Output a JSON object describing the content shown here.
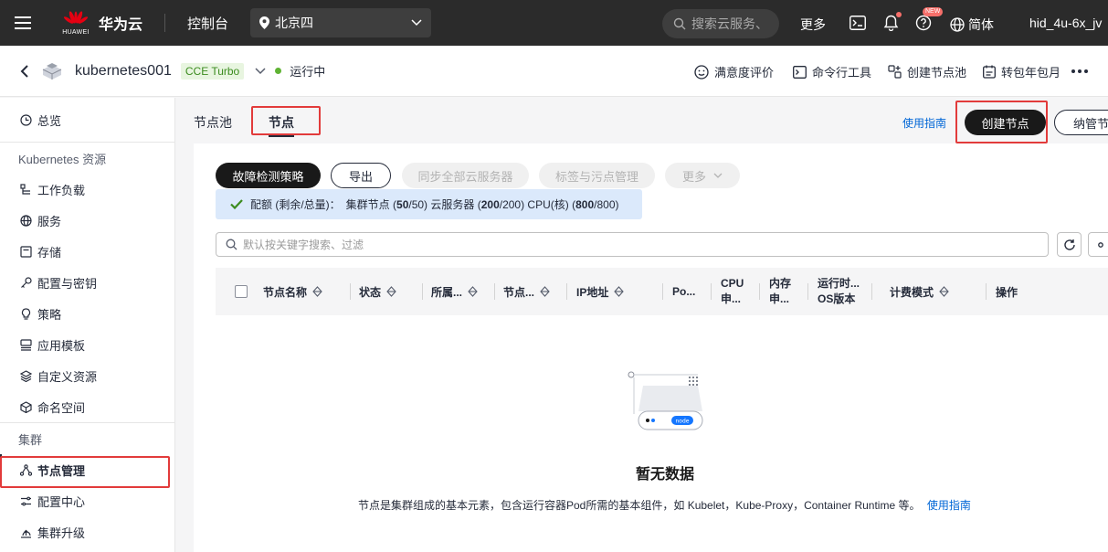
{
  "topbar": {
    "brand": "华为云",
    "logo_text": "HUAWEI",
    "console": "控制台",
    "region": "北京四",
    "search_placeholder": "搜索云服务、",
    "more": "更多",
    "new_badge": "NEW",
    "language": "简体",
    "user": "hid_4u-6x_jv"
  },
  "cluster": {
    "name": "kubernetes001",
    "type_tag": "CCE Turbo",
    "status": "运行中",
    "actions": [
      "满意度评价",
      "命令行工具",
      "创建节点池",
      "转包年包月"
    ]
  },
  "sidebar": {
    "items_top": [
      "总览"
    ],
    "group1": "Kubernetes 资源",
    "group1_items": [
      "工作负载",
      "服务",
      "存储",
      "配置与密钥",
      "策略",
      "应用模板",
      "自定义资源",
      "命名空间"
    ],
    "group2": "集群",
    "group2_items": [
      "节点管理",
      "配置中心",
      "集群升级"
    ]
  },
  "tabs": {
    "node_pool": "节点池",
    "node": "节点"
  },
  "actions": {
    "guide": "使用指南",
    "create_node": "创建节点",
    "manage_node": "纳管节点",
    "fault_policy": "故障检测策略",
    "export": "导出",
    "sync_servers": "同步全部云服务器",
    "label_taint": "标签与污点管理",
    "more": "更多"
  },
  "quota": {
    "prefix": "配额 (剩余/总量)：",
    "cluster_nodes_label": "集群节点 (",
    "cluster_nodes_remaining": "50",
    "cluster_nodes_total": "/50) 云服务器 (",
    "servers_remaining": "200",
    "servers_total": "/200) CPU(核) (",
    "cpu_remaining": "800",
    "cpu_total": "/800)"
  },
  "search": {
    "placeholder": "默认按关键字搜索、过滤"
  },
  "table": {
    "columns": [
      "节点名称",
      "状态",
      "所属...",
      "节点...",
      "IP地址",
      "Po...",
      "CPU\n申...",
      "内存\n申...",
      "运行时...\nOS版本",
      "计费模式",
      "操作"
    ]
  },
  "empty": {
    "title": "暂无数据",
    "description": "节点是集群组成的基本元素，包含运行容器Pod所需的基本组件，如 Kubelet，Kube-Proxy，Container Runtime 等。",
    "link": "使用指南",
    "node_label": "node"
  },
  "colors": {
    "accent": "#0066d6",
    "highlight": "#e23b3b",
    "running": "#5fb333"
  }
}
